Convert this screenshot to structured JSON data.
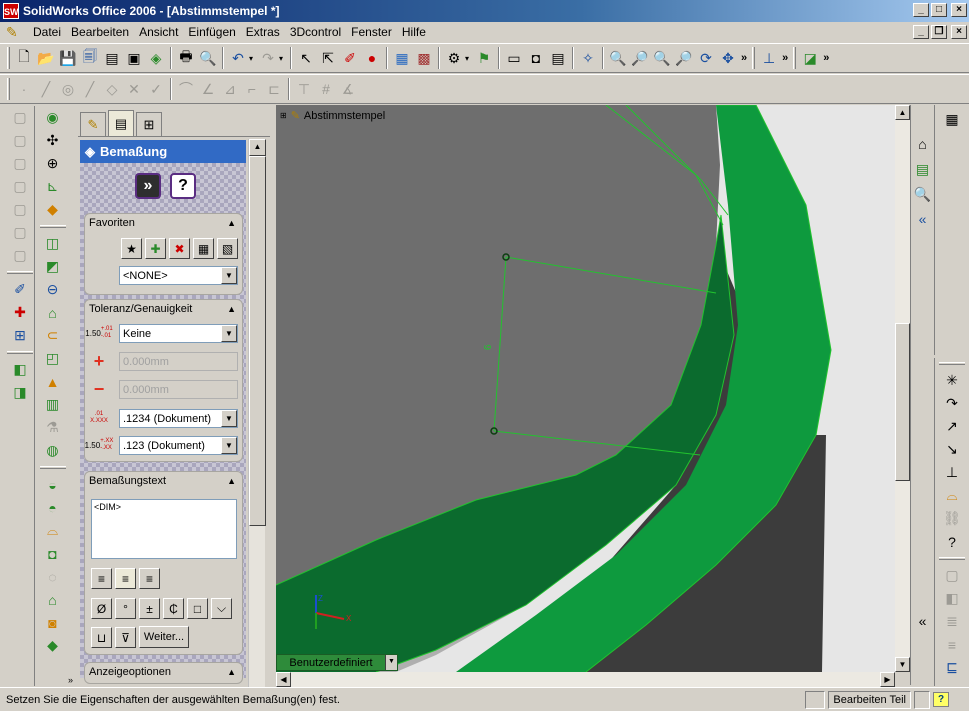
{
  "window": {
    "title": "SolidWorks Office 2006 - [Abstimmstempel *]",
    "app_icon": "SW"
  },
  "menu": {
    "items": [
      "Datei",
      "Bearbeiten",
      "Ansicht",
      "Einfügen",
      "Extras",
      "3Dcontrol",
      "Fenster",
      "Hilfe"
    ]
  },
  "property_manager": {
    "title": "Bemaßung",
    "ok_symbol": "»",
    "help_symbol": "?",
    "favoriten": {
      "title": "Favoriten",
      "value": "<NONE>"
    },
    "toleranz": {
      "title": "Toleranz/Genauigkeit",
      "type_value": "Keine",
      "upper_value": "0.000mm",
      "lower_value": "0.000mm",
      "primary_precision": ".1234 (Dokument)",
      "tolerance_precision": ".123 (Dokument)",
      "icon_labels": {
        "tol_main": "1.50",
        "tol_plus": "+.01",
        "tol_minus": "-.01",
        "prec_main": "X.XXX",
        "prec_frac": ".01",
        "prec2_main": "1.50",
        "prec2_plus": "+.XX",
        "prec2_minus": "-.XX"
      }
    },
    "bemassungstext": {
      "title": "Bemaßungstext",
      "text_value": "<DIM>",
      "symbols": [
        "Ø",
        "°",
        "±",
        "₵",
        "□",
        "⌵",
        "⊔",
        "⊽"
      ],
      "more_label": "Weiter..."
    },
    "anzeigeoptionen": {
      "title": "Anzeigeoptionen"
    }
  },
  "viewport": {
    "tree_label": "Abstimmstempel",
    "dimension_value": "6",
    "configuration": "Benutzerdefiniert",
    "colors": {
      "dark_green": "#0b6b2e",
      "bright_green": "#0e9a3e",
      "gray_face": "#6e6e6e",
      "dark_gray": "#3c3c3c",
      "light_bg": "#e6e6e6",
      "sketch_line": "#22c32e"
    }
  },
  "status": {
    "message": "Setzen Sie die Eigenschaften der ausgewählten Bemaßung(en) fest.",
    "mode": "Bearbeiten Teil",
    "help": "?"
  }
}
